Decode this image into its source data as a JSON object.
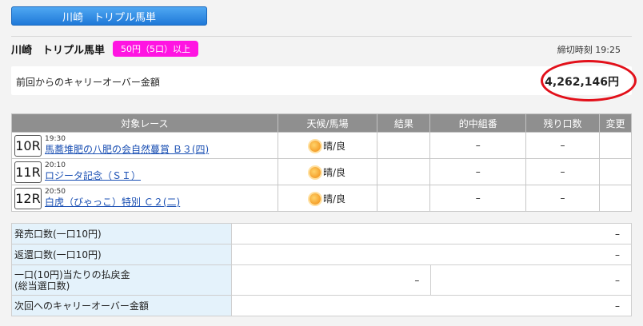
{
  "header": {
    "title": "川崎　トリプル馬単"
  },
  "race_info": {
    "title": "川崎　トリプル馬単",
    "condition_badge": "50円（5口）以上",
    "deadline": "締切時刻 19:25"
  },
  "carryover": {
    "label": "前回からのキャリーオーバー金額",
    "amount": "4,262,146円"
  },
  "races_table": {
    "headers": [
      "対象レース",
      "天候/馬場",
      "結果",
      "的中組番",
      "残り口数",
      "変更"
    ],
    "rows": [
      {
        "rno": "10R",
        "time": "19:30",
        "name": "馬蕎堆肥の八肥の会自然蔓賞 Ｂ３(四)",
        "weather": "晴/良",
        "result": "",
        "winning": "–",
        "remaining": "–",
        "change": ""
      },
      {
        "rno": "11R",
        "time": "20:10",
        "name": "ロジータ記念（ＳＩ）",
        "weather": "晴/良",
        "result": "",
        "winning": "–",
        "remaining": "–",
        "change": ""
      },
      {
        "rno": "12R",
        "time": "20:50",
        "name": "白虎（びゃっこ）特別 Ｃ２(二)",
        "weather": "晴/良",
        "result": "",
        "winning": "–",
        "remaining": "–",
        "change": ""
      }
    ]
  },
  "payout_table": {
    "sales_label": "発売口数(一口10円)",
    "sales_value": "–",
    "refund_label": "返還口数(一口10円)",
    "refund_value": "–",
    "payout_label_1": "一口(10円)当たりの払戻金",
    "payout_label_2": "(総当選口数)",
    "payout_value_a": "–",
    "payout_value_b": "–",
    "next_carry_label": "次回へのキャリーオーバー金額",
    "next_carry_value": "–"
  },
  "colors": {
    "header_blue": "#1f79d8",
    "badge_magenta": "#ff14e2",
    "highlight_red": "#e2101a",
    "table_header_gray": "#8f8f8f",
    "label_bg": "#e4f2fb"
  },
  "icons": {
    "weather": "sun-icon"
  }
}
